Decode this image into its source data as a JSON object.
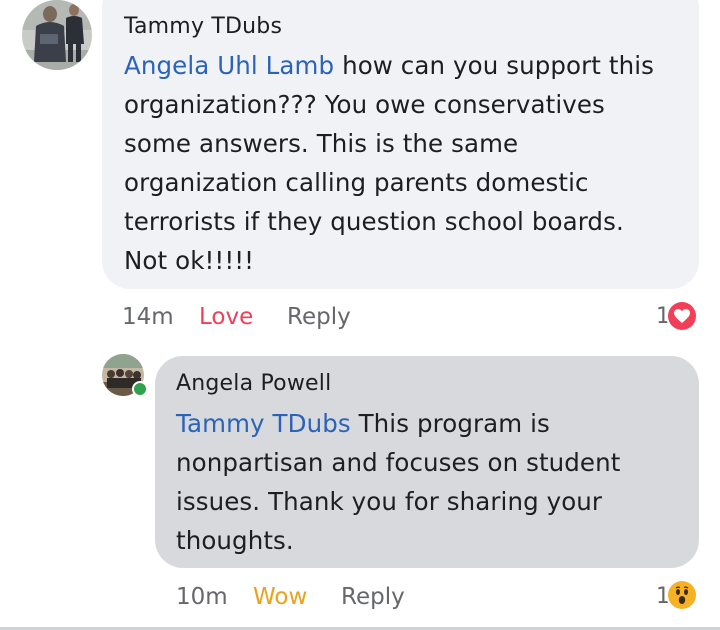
{
  "comments": [
    {
      "author": "Tammy TDubs",
      "mention": "Angela Uhl Lamb",
      "lines": [
        "how can you support this",
        "organization??? You owe conservatives",
        "some answers. This is the same",
        "organization calling parents domestic",
        "terrorists if they question school boards.",
        "Not ok!!!!!"
      ],
      "time": "14m",
      "reaction_action": "Love",
      "reply_label": "Reply",
      "reaction_count": "1",
      "reaction_icon": "love-heart-icon",
      "reaction_color": "#f33e58",
      "bubble_color": "#f0f2f5"
    },
    {
      "author": "Angela Powell",
      "mention": "Tammy TDubs",
      "lines": [
        "This program is",
        "nonpartisan and focuses on student",
        "issues.  Thank you for sharing your",
        "thoughts."
      ],
      "time": "10m",
      "reaction_action": "Wow",
      "reply_label": "Reply",
      "reaction_count": "1",
      "reaction_icon": "wow-face-icon",
      "reaction_color": "#f7b125",
      "bubble_color": "#d7d9dc",
      "online_status_color": "#31a24c"
    }
  ],
  "colors": {
    "mention": "#2b63b8",
    "love": "#f33e58",
    "wow": "#eaa21c",
    "meta": "#65676b"
  }
}
